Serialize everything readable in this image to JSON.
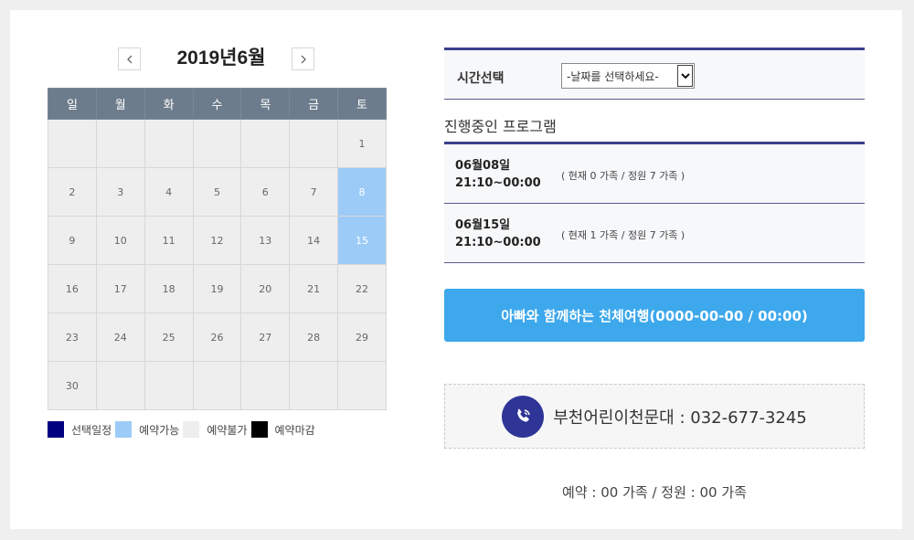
{
  "calendar": {
    "title": "2019년6월",
    "prev_label": "‹",
    "next_label": "›",
    "weekdays": [
      "일",
      "월",
      "화",
      "수",
      "목",
      "금",
      "토"
    ],
    "weeks": [
      [
        "",
        "",
        "",
        "",
        "",
        "",
        "1"
      ],
      [
        "2",
        "3",
        "4",
        "5",
        "6",
        "7",
        "8"
      ],
      [
        "9",
        "10",
        "11",
        "12",
        "13",
        "14",
        "15"
      ],
      [
        "16",
        "17",
        "18",
        "19",
        "20",
        "21",
        "22"
      ],
      [
        "23",
        "24",
        "25",
        "26",
        "27",
        "28",
        "29"
      ],
      [
        "30",
        "",
        "",
        "",
        "",
        "",
        ""
      ]
    ],
    "available_days": [
      "8",
      "15"
    ],
    "colors": {
      "header": "#6d7c8c",
      "available": "#9dcbf7",
      "cell": "#eeeeee"
    }
  },
  "legend": [
    {
      "label": "선택일정",
      "color": "#000080"
    },
    {
      "label": "예약가능",
      "color": "#9dcbf7"
    },
    {
      "label": "예약불가",
      "color": "#eeeeee"
    },
    {
      "label": "예약마감",
      "color": "#000000"
    }
  ],
  "time_select": {
    "label": "시간선택",
    "selected": "-날짜를 선택하세요-"
  },
  "programs": {
    "title": "진행중인 프로그램",
    "items": [
      {
        "date": "06월08일",
        "time": "21:10~00:00",
        "count": "( 현재 0 가족 / 정원 7 가족 )"
      },
      {
        "date": "06월15일",
        "time": "21:10~00:00",
        "count": "( 현재 1 가족 / 정원 7 가족 )"
      }
    ]
  },
  "main_button": {
    "label": "아빠와 함께하는 천체여행(0000-00-00 / 00:00)",
    "color": "#3da8ec"
  },
  "contact": {
    "text": "부천어린이천문대 : 032-677-3245",
    "icon": "phone-icon",
    "icon_color": "#2f3497"
  },
  "summary": {
    "text": "예약 : 00 가족 / 정원 : 00 가족"
  }
}
